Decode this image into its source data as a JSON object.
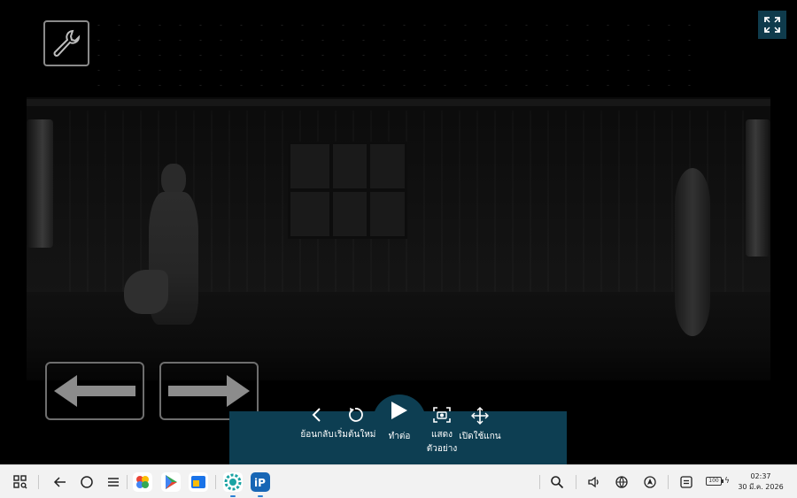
{
  "game": {
    "tool_icon": "wrench-icon",
    "fullscreen_icon": "fullscreen-icon",
    "left_arrow_icon": "arrow-left-icon",
    "right_arrow_icon": "arrow-right-icon"
  },
  "pause_menu": {
    "back_label": "ย้อนกลับ",
    "restart_label": "เริ่มต้นใหม่",
    "continue_label": "ทำต่อ",
    "show_label_line1": "แสดง",
    "show_label_line2": "ตัวอย่าง",
    "open_label": "เปิดใช้แกน"
  },
  "taskbar": {
    "time": "02:37",
    "date": "30 มี.ค. 2026",
    "battery": "100",
    "icons": [
      "app-grid-icon",
      "back-icon",
      "home-icon",
      "menu-icon",
      "photos-icon",
      "play-store-icon",
      "app-icon",
      "gear-app-icon",
      "ip-app-icon",
      "search-icon",
      "volume-icon",
      "network-icon",
      "location-icon",
      "notes-icon",
      "battery-icon"
    ]
  },
  "colors": {
    "panel": "#0d3e52",
    "taskbar": "#f2f2f2"
  }
}
